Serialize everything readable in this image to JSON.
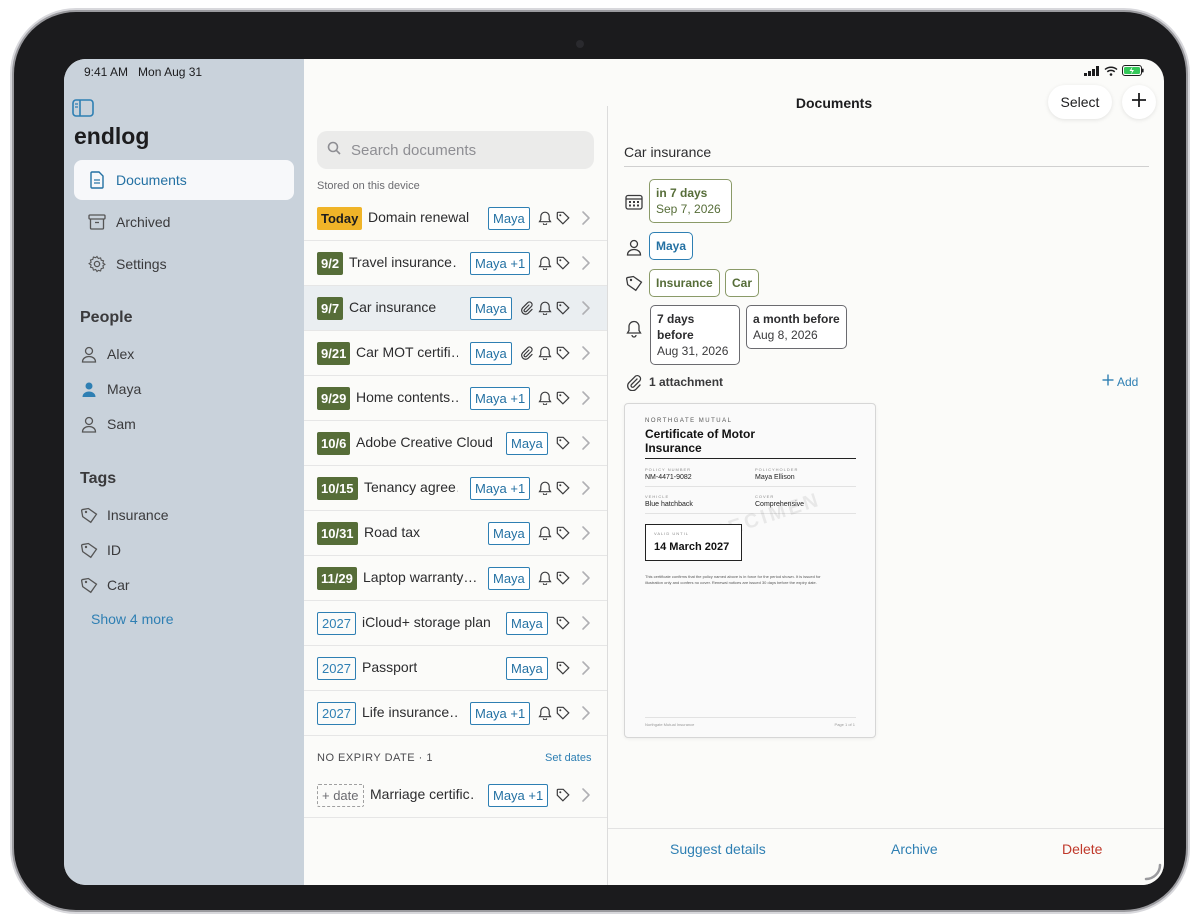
{
  "status": {
    "time": "9:41 AM",
    "date": "Mon Aug 31"
  },
  "sidebar": {
    "app_title": "endlog",
    "nav": [
      {
        "label": "Documents",
        "icon": "document-icon",
        "active": true
      },
      {
        "label": "Archived",
        "icon": "archive-box-icon",
        "active": false
      },
      {
        "label": "Settings",
        "icon": "gear-icon",
        "active": false
      }
    ],
    "people_title": "People",
    "people": [
      {
        "label": "Alex",
        "filled": false
      },
      {
        "label": "Maya",
        "filled": true
      },
      {
        "label": "Sam",
        "filled": false
      }
    ],
    "tags_title": "Tags",
    "tags": [
      {
        "label": "Insurance"
      },
      {
        "label": "ID"
      },
      {
        "label": "Car"
      }
    ],
    "show_more": "Show 4 more"
  },
  "list": {
    "search_placeholder": "Search documents",
    "caption": "Stored on this device",
    "rows": [
      {
        "badge": "Today",
        "badge_style": "today",
        "name": "Domain renewal",
        "person": "Maya",
        "attach": false,
        "bell": true,
        "tag": true,
        "selected": false
      },
      {
        "badge": "9/2",
        "badge_style": "green",
        "name": "Travel insurance…",
        "person": "Maya +1",
        "attach": false,
        "bell": true,
        "tag": true,
        "selected": false
      },
      {
        "badge": "9/7",
        "badge_style": "green",
        "name": "Car insurance",
        "person": "Maya",
        "attach": true,
        "bell": true,
        "tag": true,
        "selected": true
      },
      {
        "badge": "9/21",
        "badge_style": "green",
        "name": "Car MOT certifi…",
        "person": "Maya",
        "attach": true,
        "bell": true,
        "tag": true,
        "selected": false
      },
      {
        "badge": "9/29",
        "badge_style": "green",
        "name": "Home contents…",
        "person": "Maya +1",
        "attach": false,
        "bell": true,
        "tag": true,
        "selected": false
      },
      {
        "badge": "10/6",
        "badge_style": "green",
        "name": "Adobe Creative Cloud",
        "person": "Maya",
        "attach": false,
        "bell": false,
        "tag": true,
        "selected": false
      },
      {
        "badge": "10/15",
        "badge_style": "green",
        "name": "Tenancy agree…",
        "person": "Maya +1",
        "attach": false,
        "bell": true,
        "tag": true,
        "selected": false
      },
      {
        "badge": "10/31",
        "badge_style": "green",
        "name": "Road tax",
        "person": "Maya",
        "attach": false,
        "bell": true,
        "tag": true,
        "selected": false
      },
      {
        "badge": "11/29",
        "badge_style": "green",
        "name": "Laptop warranty…",
        "person": "Maya",
        "attach": false,
        "bell": true,
        "tag": true,
        "selected": false
      },
      {
        "badge": "2027",
        "badge_style": "year",
        "name": "iCloud+ storage plan",
        "person": "Maya",
        "attach": false,
        "bell": false,
        "tag": true,
        "selected": false
      },
      {
        "badge": "2027",
        "badge_style": "year",
        "name": "Passport",
        "person": "Maya",
        "attach": false,
        "bell": false,
        "tag": true,
        "selected": false
      },
      {
        "badge": "2027",
        "badge_style": "year",
        "name": "Life insurance…",
        "person": "Maya +1",
        "attach": false,
        "bell": true,
        "tag": true,
        "selected": false
      }
    ],
    "no_expiry_label": "NO EXPIRY DATE · 1",
    "set_dates": "Set dates",
    "no_expiry_rows": [
      {
        "badge": "+ date",
        "badge_style": "dashed",
        "name": "Marriage certific…",
        "person": "Maya +1",
        "attach": false,
        "bell": false,
        "tag": true,
        "selected": false
      }
    ]
  },
  "header": {
    "title": "Documents",
    "select_label": "Select"
  },
  "detail": {
    "title": "Car insurance",
    "expiry_relative": "in 7 days",
    "expiry_date": "Sep 7, 2026",
    "person": "Maya",
    "tags": [
      "Insurance",
      "Car"
    ],
    "reminders": [
      {
        "label": "7 days before",
        "date": "Aug 31, 2026"
      },
      {
        "label": "a month before",
        "date": "Aug 8, 2026"
      }
    ],
    "attachment_label": "1 attachment",
    "add_label": "Add",
    "certificate": {
      "issuer": "NORTHGATE MUTUAL",
      "title": "Certificate of Motor Insurance",
      "policy_number_label": "POLICY NUMBER",
      "policy_number": "NM-4471-9082",
      "policyholder_label": "POLICYHOLDER",
      "policyholder": "Maya Ellison",
      "vehicle_label": "VEHICLE",
      "vehicle": "Blue hatchback",
      "cover_label": "COVER",
      "cover": "Comprehensive",
      "valid_until_label": "VALID UNTIL",
      "valid_until": "14 March 2027",
      "watermark": "SPECIMEN",
      "body": "This certificate confirms that the policy named above is in force for the period shown. It is issued for illustration only and confers no cover. Renewal notices are issued 30 days before the expiry date.",
      "footer_left": "Northgate Mutual Insurance",
      "footer_right": "Page 1 of 1"
    }
  },
  "toolbar": {
    "suggest": "Suggest details",
    "archive": "Archive",
    "delete": "Delete"
  },
  "colors": {
    "accent": "#2e7fb3",
    "olive": "#566d38",
    "today": "#f0b428",
    "delete": "#c0392b",
    "sidebar": "#c9d2db"
  }
}
